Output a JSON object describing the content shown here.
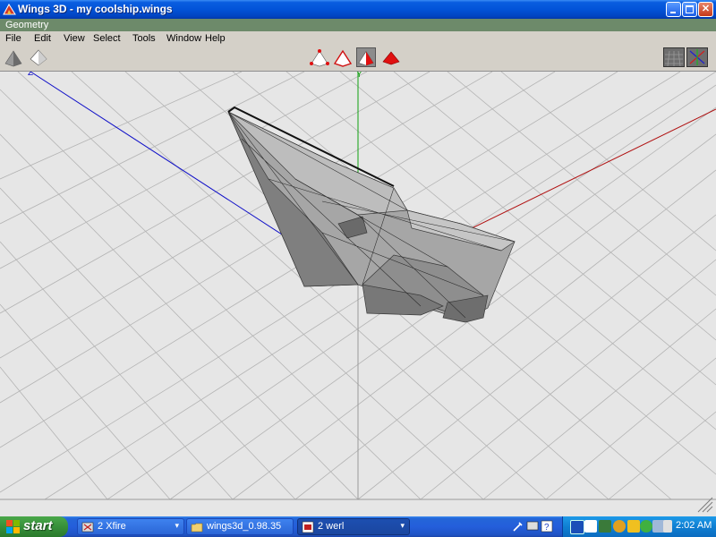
{
  "window": {
    "title": "Wings 3D - my coolship.wings"
  },
  "geometry_bar": {
    "label": "Geometry"
  },
  "menu": [
    {
      "label": "File"
    },
    {
      "label": "Edit"
    },
    {
      "label": "View"
    },
    {
      "label": "Select"
    },
    {
      "label": "Tools"
    },
    {
      "label": "Window"
    },
    {
      "label": "Help"
    }
  ],
  "toolbar": {
    "left_icons": [
      "ground-shaded-pyramid-icon",
      "ground-white-pyramid-icon"
    ],
    "selection_modes": [
      "vertex-mode-icon",
      "edge-mode-icon",
      "face-mode-icon",
      "body-mode-icon"
    ],
    "selected_mode": "face-mode-icon",
    "right_icons": [
      "grid-toggle-icon",
      "axes-toggle-icon"
    ]
  },
  "viewport": {
    "axis_labels": {
      "y": "Y",
      "z": "Z"
    },
    "colors": {
      "x_axis": "#b01010",
      "y_axis": "#10a010",
      "z_axis": "#1010c8",
      "grid": "#b0b0b0",
      "background": "#e6e6e6",
      "model": "#a6a6a6"
    }
  },
  "taskbar": {
    "start_label": "start",
    "tasks": [
      {
        "label": "2 Xfire"
      },
      {
        "label": "wings3d_0.98.35"
      },
      {
        "label": "2 werl"
      }
    ],
    "clock": "2:02 AM"
  }
}
